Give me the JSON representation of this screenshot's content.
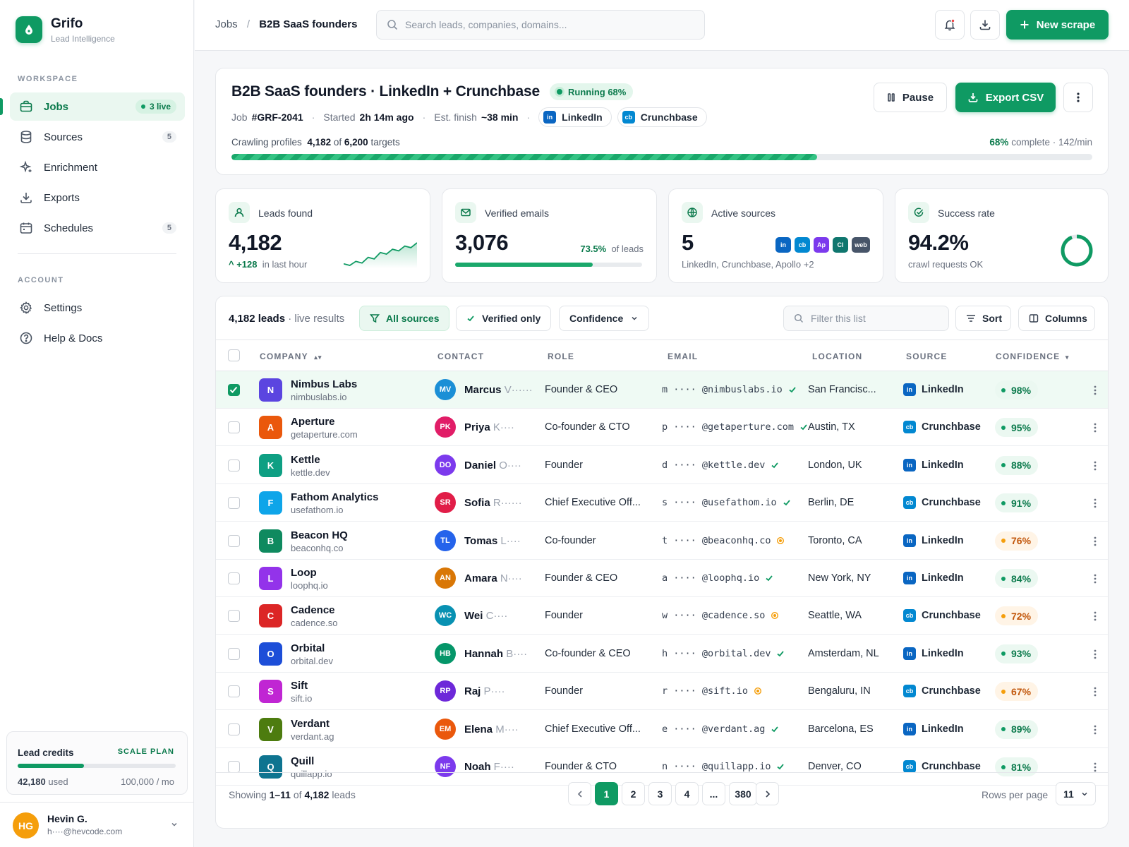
{
  "brand": {
    "name": "Grifo",
    "subtitle": "Lead Intelligence"
  },
  "sidebar": {
    "workspace_label": "WORKSPACE",
    "account_label": "ACCOUNT",
    "items": [
      {
        "label": "Jobs",
        "badge": "3 live",
        "icon": "briefcase-icon"
      },
      {
        "label": "Sources",
        "badge": "5",
        "icon": "database-icon"
      },
      {
        "label": "Enrichment",
        "badge": "",
        "icon": "sparkle-icon"
      },
      {
        "label": "Exports",
        "badge": "",
        "icon": "download-icon"
      },
      {
        "label": "Schedules",
        "badge": "5",
        "icon": "calendar-icon"
      }
    ],
    "account_items": [
      {
        "label": "Settings",
        "icon": "gear-icon"
      },
      {
        "label": "Help & Docs",
        "icon": "help-icon"
      }
    ],
    "credits": {
      "title": "Lead credits",
      "plan": "SCALE PLAN",
      "used": "42,180",
      "used_suffix": "used",
      "limit": "100,000 / mo",
      "used_fraction": 0.4218
    },
    "user": {
      "initials": "HG",
      "name": "Hevin G.",
      "email": "h····@hevcode.com"
    }
  },
  "header": {
    "breadcrumb_root": "Jobs",
    "breadcrumb_sep": "/",
    "breadcrumb_current": "B2B SaaS founders",
    "search_placeholder": "Search leads, companies, domains...",
    "new_scrape": "New scrape"
  },
  "job": {
    "title": "B2B SaaS founders · LinkedIn + Crunchbase",
    "status": "Running 68%",
    "job_label": "Job",
    "job_id": "#GRF-2041",
    "started_label": "Started",
    "started": "2h 14m ago",
    "finish_label": "Est. finish",
    "finish": "~38 min",
    "sources": [
      "LinkedIn",
      "Crunchbase"
    ],
    "pause": "Pause",
    "export": "Export CSV",
    "crawl_label": "Crawling profiles",
    "crawled": "4,182",
    "of": "of",
    "targets_count": "6,200",
    "targets_label": "targets",
    "pct_text": "68%",
    "complete_text": "complete · 142/min",
    "progress": 0.68
  },
  "stats": {
    "leads": {
      "label": "Leads found",
      "value": "4,182",
      "delta": "+128",
      "delta_label": "in last hour",
      "trend": [
        30,
        28,
        33,
        31,
        38,
        36,
        44,
        42,
        48,
        46,
        52,
        50,
        56
      ]
    },
    "emails": {
      "label": "Verified emails",
      "value": "3,076",
      "pct": "73.5%",
      "pct_label": "of leads",
      "fraction": 0.735
    },
    "sources": {
      "label": "Active sources",
      "value": "5",
      "caption": "LinkedIn, Crunchbase, Apollo +2",
      "badges": [
        {
          "t": "in",
          "c": "#0a66c2"
        },
        {
          "t": "cb",
          "c": "#0288d1"
        },
        {
          "t": "Ap",
          "c": "#7c3aed"
        },
        {
          "t": "Cl",
          "c": "#0f766e"
        },
        {
          "t": "web",
          "c": "#475569"
        }
      ]
    },
    "success": {
      "label": "Success rate",
      "value": "94.2%",
      "caption": "crawl requests OK",
      "fraction": 0.942
    }
  },
  "table": {
    "count": "4,182 leads",
    "count_suffix": " · live results",
    "filters": {
      "all_sources": "All sources",
      "verified": "Verified only",
      "confidence": "Confidence"
    },
    "filter_placeholder": "Filter this list",
    "sort": "Sort",
    "columns": "Columns",
    "headers": [
      "COMPANY",
      "CONTACT",
      "ROLE",
      "EMAIL",
      "LOCATION",
      "SOURCE",
      "CONFIDENCE"
    ],
    "rows": [
      {
        "letter": "N",
        "color": "#5b45e0",
        "company": "Nimbus Labs",
        "domain": "nimbuslabs.io",
        "initials": "MV",
        "acolor": "#1b8fd6",
        "first": "Marcus",
        "rest": "V······",
        "role": "Founder & CEO",
        "email_pre": "m ····",
        "email_dom": "@nimbuslabs.io",
        "verified": true,
        "location": "San Francisc...",
        "source": "LinkedIn",
        "conf": "98%",
        "selected": true
      },
      {
        "letter": "A",
        "color": "#ea580c",
        "company": "Aperture",
        "domain": "getaperture.com",
        "initials": "PK",
        "acolor": "#e11d67",
        "first": "Priya",
        "rest": "K····",
        "role": "Co-founder & CTO",
        "email_pre": "p ····",
        "email_dom": "@getaperture.com",
        "verified": true,
        "location": "Austin, TX",
        "source": "Crunchbase",
        "conf": "95%",
        "selected": false
      },
      {
        "letter": "K",
        "color": "#0e9f83",
        "company": "Kettle",
        "domain": "kettle.dev",
        "initials": "DO",
        "acolor": "#7c3aed",
        "first": "Daniel",
        "rest": "O····",
        "role": "Founder",
        "email_pre": "d ····",
        "email_dom": "@kettle.dev",
        "verified": true,
        "location": "London, UK",
        "source": "LinkedIn",
        "conf": "88%",
        "selected": false
      },
      {
        "letter": "F",
        "color": "#0ea5e9",
        "company": "Fathom Analytics",
        "domain": "usefathom.io",
        "initials": "SR",
        "acolor": "#e11d48",
        "first": "Sofia",
        "rest": "R······",
        "role": "Chief Executive Off...",
        "email_pre": "s ····",
        "email_dom": "@usefathom.io",
        "verified": true,
        "location": "Berlin, DE",
        "source": "Crunchbase",
        "conf": "91%",
        "selected": false
      },
      {
        "letter": "B",
        "color": "#0f8a5f",
        "company": "Beacon HQ",
        "domain": "beaconhq.co",
        "initials": "TL",
        "acolor": "#2563eb",
        "first": "Tomas",
        "rest": "L····",
        "role": "Co-founder",
        "email_pre": "t ····",
        "email_dom": "@beaconhq.co",
        "verified": false,
        "location": "Toronto, CA",
        "source": "LinkedIn",
        "conf": "76%",
        "selected": false
      },
      {
        "letter": "L",
        "color": "#9333ea",
        "company": "Loop",
        "domain": "loophq.io",
        "initials": "AN",
        "acolor": "#d97706",
        "first": "Amara",
        "rest": "N····",
        "role": "Founder & CEO",
        "email_pre": "a ····",
        "email_dom": "@loophq.io",
        "verified": true,
        "location": "New York, NY",
        "source": "LinkedIn",
        "conf": "84%",
        "selected": false
      },
      {
        "letter": "C",
        "color": "#dc2626",
        "company": "Cadence",
        "domain": "cadence.so",
        "initials": "WC",
        "acolor": "#0891b2",
        "first": "Wei",
        "rest": "C····",
        "role": "Founder",
        "email_pre": "w ····",
        "email_dom": "@cadence.so",
        "verified": false,
        "location": "Seattle, WA",
        "source": "Crunchbase",
        "conf": "72%",
        "selected": false
      },
      {
        "letter": "O",
        "color": "#1d4ed8",
        "company": "Orbital",
        "domain": "orbital.dev",
        "initials": "HB",
        "acolor": "#059669",
        "first": "Hannah",
        "rest": "B····",
        "role": "Co-founder & CEO",
        "email_pre": "h ····",
        "email_dom": "@orbital.dev",
        "verified": true,
        "location": "Amsterdam, NL",
        "source": "LinkedIn",
        "conf": "93%",
        "selected": false
      },
      {
        "letter": "S",
        "color": "#c026d3",
        "company": "Sift",
        "domain": "sift.io",
        "initials": "RP",
        "acolor": "#6d28d9",
        "first": "Raj",
        "rest": "P····",
        "role": "Founder",
        "email_pre": "r ····",
        "email_dom": "@sift.io",
        "verified": false,
        "location": "Bengaluru, IN",
        "source": "Crunchbase",
        "conf": "67%",
        "selected": false
      },
      {
        "letter": "V",
        "color": "#4d7c0f",
        "company": "Verdant",
        "domain": "verdant.ag",
        "initials": "EM",
        "acolor": "#ea580c",
        "first": "Elena",
        "rest": "M····",
        "role": "Chief Executive Off...",
        "email_pre": "e ····",
        "email_dom": "@verdant.ag",
        "verified": true,
        "location": "Barcelona, ES",
        "source": "LinkedIn",
        "conf": "89%",
        "selected": false
      },
      {
        "letter": "Q",
        "color": "#0e7490",
        "company": "Quill",
        "domain": "quillapp.io",
        "initials": "NF",
        "acolor": "#7c3aed",
        "first": "Noah",
        "rest": "F····",
        "role": "Founder & CTO",
        "email_pre": "n ····",
        "email_dom": "@quillapp.io",
        "verified": true,
        "location": "Denver, CO",
        "source": "Crunchbase",
        "conf": "81%",
        "selected": false
      }
    ],
    "footer": {
      "showing": "Showing",
      "range": "1–11",
      "of": "of",
      "total": "4,182",
      "leads": "leads",
      "pages": [
        "1",
        "2",
        "3",
        "4",
        "...",
        "380"
      ],
      "rows_label": "Rows per page",
      "rows_value": "11"
    }
  },
  "colors": {
    "accent": "#0f9a63",
    "linkedin": "#0a66c2",
    "crunchbase": "#0288d1",
    "warn": "#f59e0b"
  }
}
